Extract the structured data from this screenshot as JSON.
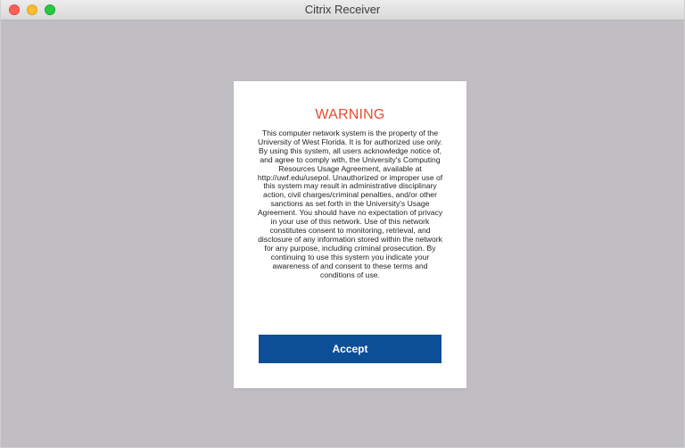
{
  "window": {
    "title": "Citrix Receiver",
    "controls": [
      "close",
      "minimize",
      "maximize"
    ]
  },
  "dialog": {
    "heading": "WARNING",
    "message": "This computer network system is the property of the University of West Florida. It is for authorized use only. By using this system, all users acknowledge notice of, and agree to comply with, the University's Computing Resources Usage Agreement, available at http://uwf.edu/usepol. Unauthorized or improper use of this system may result in administrative disciplinary action, civil charges/criminal penalties, and/or other sanctions as set forth in the University's Usage Agreement. You should have no expectation of privacy in your use of this network. Use of this network constitutes consent to monitoring, retrieval, and disclosure of any information stored within the network for any purpose, including criminal prosecution. By continuing to use this system you indicate your awareness of and consent to these terms and conditions of use.",
    "accept_label": "Accept"
  },
  "colors": {
    "heading": "#e54c2e",
    "accept_button": "#0d4f97",
    "background": "#c1bec3"
  }
}
